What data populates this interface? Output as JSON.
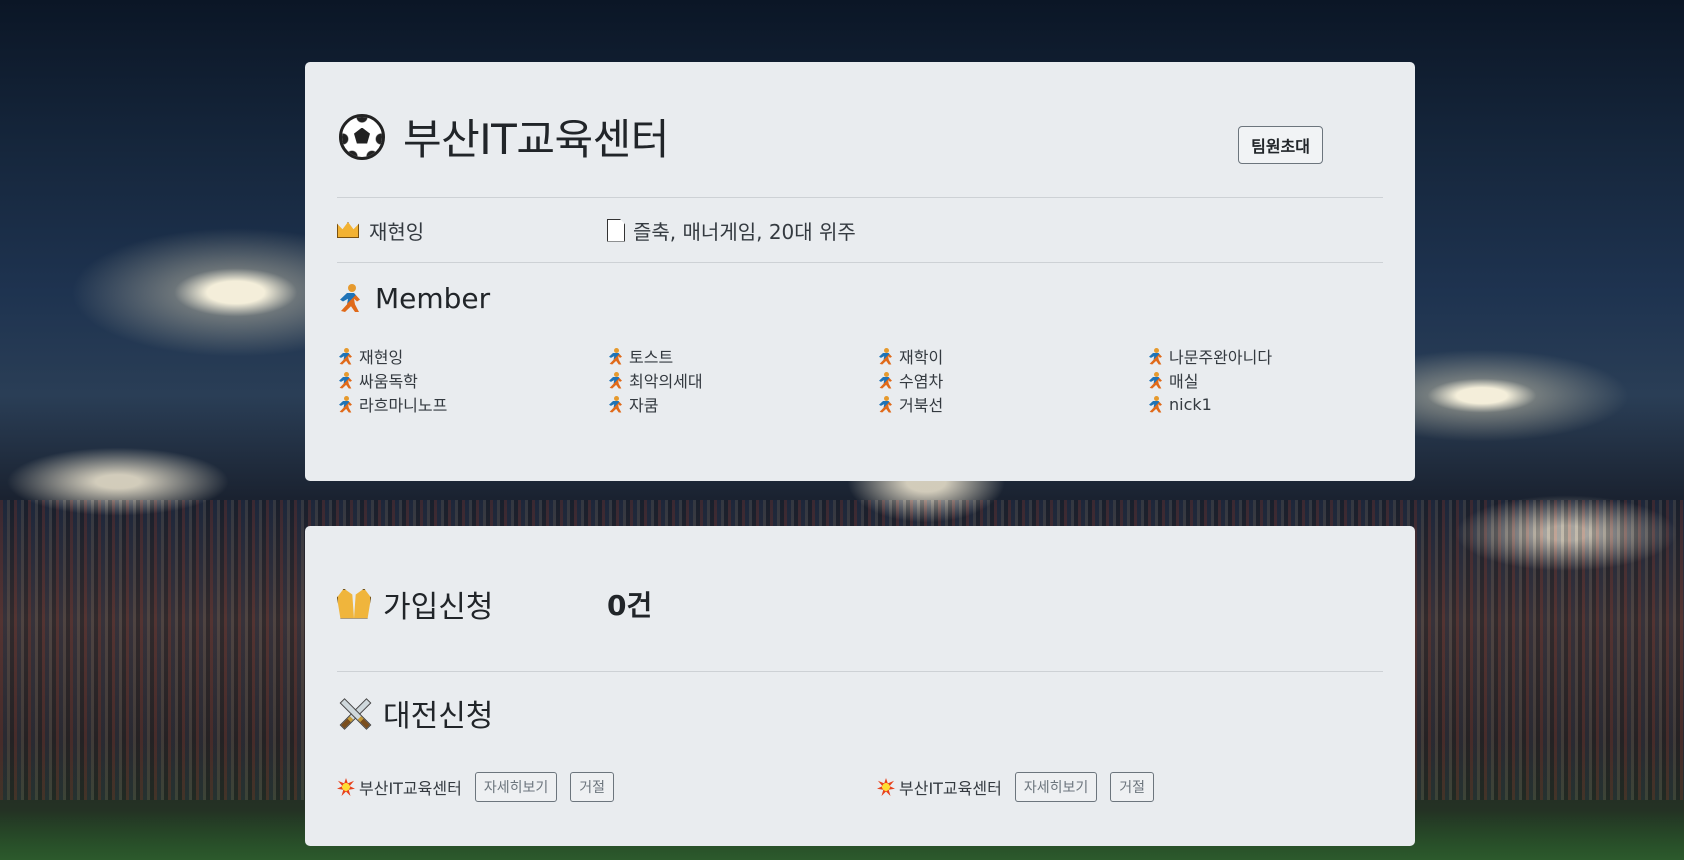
{
  "team": {
    "name": "부산IT교육센터",
    "invite_label": "팀원초대",
    "leader": "재현잉",
    "description": "즐축, 매너게임, 20대 위주"
  },
  "members": {
    "title": "Member",
    "list": [
      "재현잉",
      "토스트",
      "재학이",
      "나문주완아니다",
      "싸움독학",
      "최악의세대",
      "수염차",
      "매실",
      "라흐마니노프",
      "자쿰",
      "거북선",
      "nick1"
    ]
  },
  "join_requests": {
    "label": "가입신청",
    "count": "0건"
  },
  "match_requests": {
    "label": "대전신청",
    "items": [
      {
        "team": "부산IT교육센터",
        "detail_label": "자세히보기",
        "reject_label": "거절"
      },
      {
        "team": "부산IT교육센터",
        "detail_label": "자세히보기",
        "reject_label": "거절"
      }
    ]
  },
  "icons": {
    "team": "soccer-ball-icon",
    "leader": "crown-icon",
    "description": "document-icon",
    "member": "runner-icon",
    "join": "praying-hands-icon",
    "match": "crossed-swords-icon",
    "match_item": "collision-icon"
  },
  "colors": {
    "panel_bg": "#e9ecef",
    "text": "#212529",
    "button_border": "#6c757d"
  }
}
